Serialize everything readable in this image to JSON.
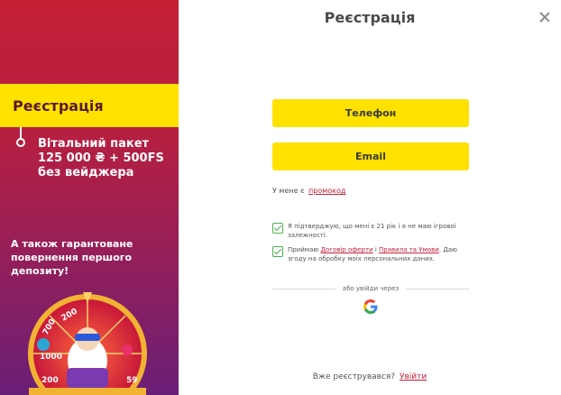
{
  "promo": {
    "title": "Реєстрація",
    "bonus_line1": "Вітальний пакет",
    "bonus_line2": "125 000 ₴ + 500FS",
    "bonus_line3": "без вейджера",
    "guarantee": "А також гарантоване повернення першого депозиту!",
    "wheel_numbers": [
      "200",
      "700",
      "1000",
      "200",
      "59"
    ]
  },
  "modal": {
    "title": "Реєстрація",
    "phone_button": "Телефон",
    "email_button": "Email",
    "promo_prefix": "У мене є",
    "promo_link": "промокод",
    "consent_age": "Я підтверджую, що мені є 21 рік і я не маю ігрової залежності.",
    "consent_terms_prefix": "Приймаю",
    "consent_terms_link1": "Договір оферти",
    "consent_terms_sep": "і",
    "consent_terms_link2": "Правила та Умови",
    "consent_terms_suffix": ". Даю згоду на обробку моїх персональних даних.",
    "social_divider": "або увійди через",
    "google_icon": "google-icon",
    "login_prefix": "Вже реєструвався?",
    "login_link": "Увійти"
  },
  "colors": {
    "accent_yellow": "#ffe200",
    "link_red": "#c4203b",
    "check_green": "#4caf50"
  }
}
